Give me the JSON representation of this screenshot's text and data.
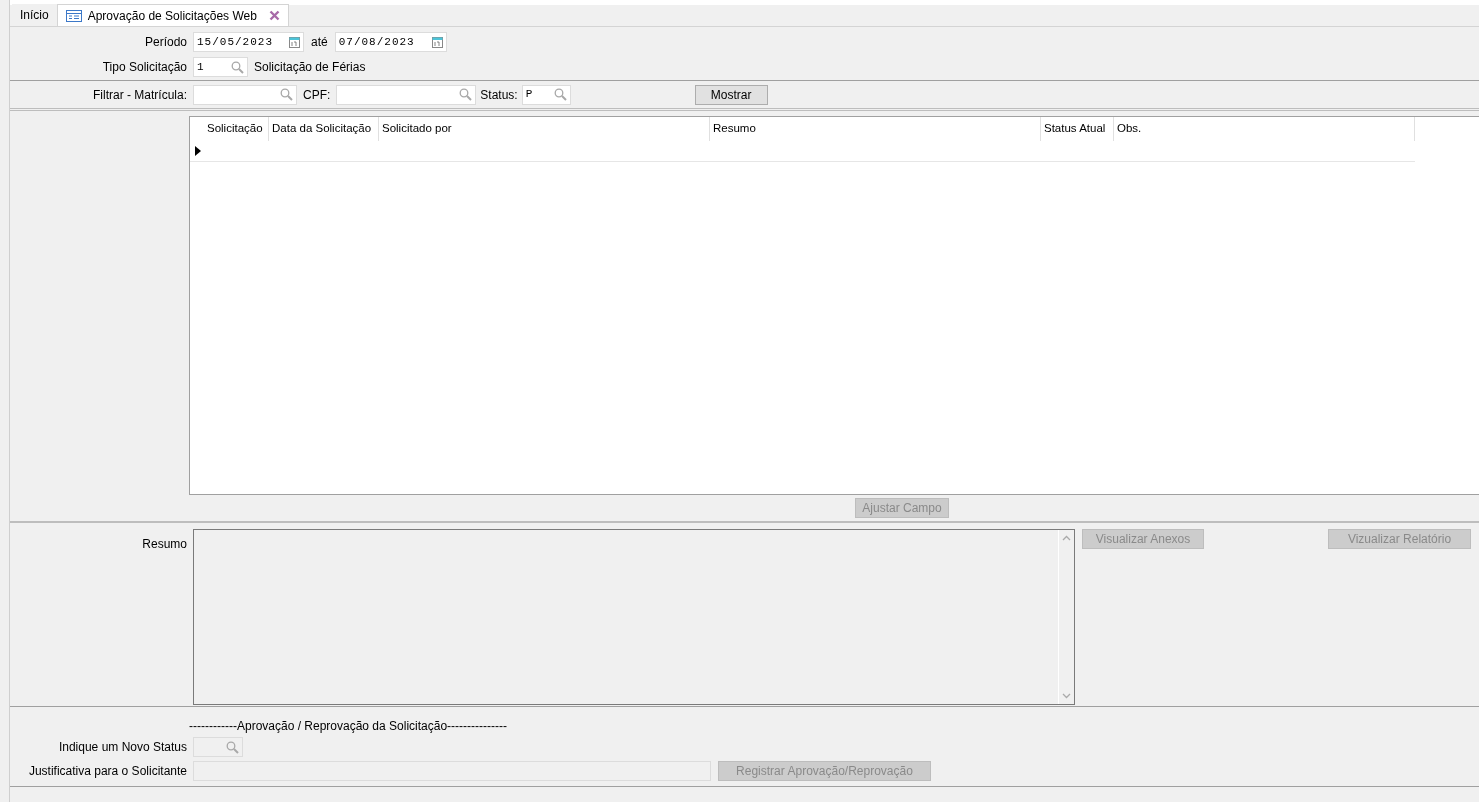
{
  "tabs": [
    {
      "label": "Início",
      "selected": false,
      "closable": false
    },
    {
      "label": "Aprovação de Solicitações Web",
      "selected": true,
      "closable": true
    }
  ],
  "periodo": {
    "label": "Período",
    "from": "15/05/2023",
    "separator": "até",
    "to": "07/08/2023"
  },
  "tipo": {
    "label": "Tipo Solicitação",
    "value": "1",
    "description": "Solicitação de Férias"
  },
  "filter": {
    "matricula_label": "Filtrar - Matrícula:",
    "cpf_label": "CPF:",
    "status_label": "Status:",
    "status_value": "P",
    "button": "Mostrar"
  },
  "grid": {
    "columns": [
      "Solicitação",
      "Data da Solicitação",
      "Solicitado por",
      "Resumo",
      "Status Atual",
      "Obs."
    ]
  },
  "adjust_button": {
    "label": "Ajustar Campo",
    "disabled": true
  },
  "resumo": {
    "label": "Resumo"
  },
  "side_buttons": [
    {
      "label": "Visualizar Anexos",
      "disabled": true
    },
    {
      "label": "Vizualizar Relatório",
      "disabled": true
    }
  ],
  "approval": {
    "heading": "------------Aprovação / Reprovação da Solicitação---------------",
    "status_label": "Indique um Novo Status",
    "justification_label": "Justificativa para o Solicitante",
    "button": {
      "label": "Registrar Aprovação/Reprovação",
      "disabled": true
    }
  }
}
